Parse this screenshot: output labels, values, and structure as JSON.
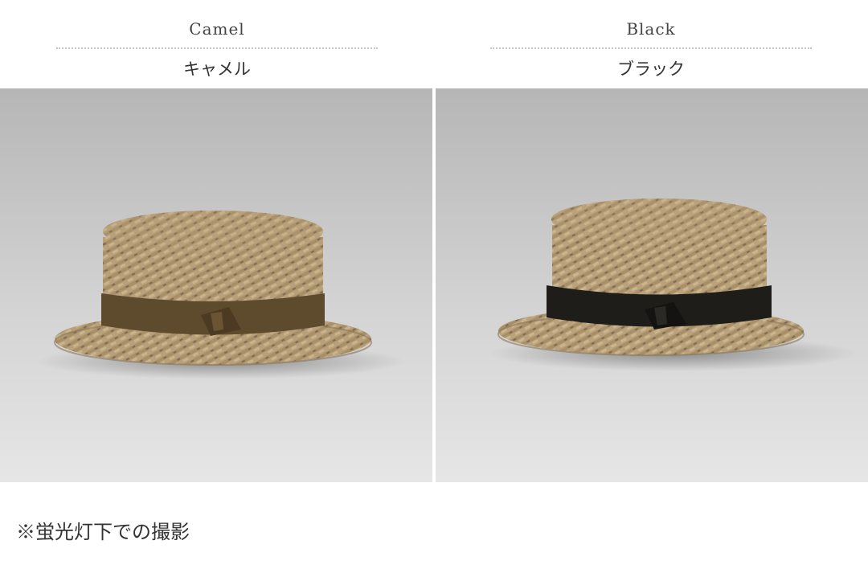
{
  "variants": [
    {
      "name_en": "Camel",
      "name_jp": "キャメル",
      "band_color": "#5e4a2c"
    },
    {
      "name_en": "Black",
      "name_jp": "ブラック",
      "band_color": "#1e1d1a"
    }
  ],
  "note": "※蛍光灯下での撮影",
  "colors": {
    "background_photo_top": "#b9b9b9",
    "background_photo_bottom": "#e4e4e4",
    "straw": "#b39c76"
  }
}
